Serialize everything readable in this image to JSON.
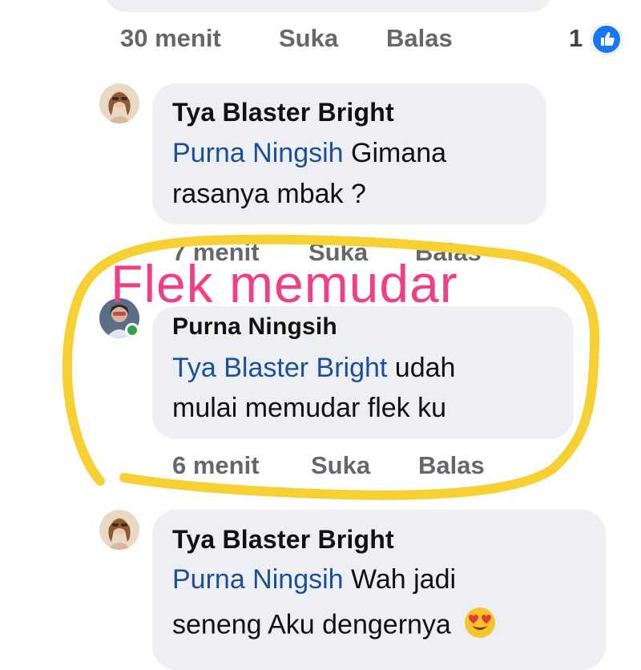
{
  "top_comment": {
    "time": "30 menit",
    "like_label": "Suka",
    "reply_label": "Balas",
    "reaction_count": "1",
    "reaction_icon": "thumbs-up-icon"
  },
  "replies": [
    {
      "author": "Tya Blaster Bright",
      "mention": "Purna Ningsih",
      "text_line1": " Gimana",
      "text_line2": "rasanya mbak ?",
      "time": "7 menit",
      "like_label": "Suka",
      "reply_label": "Balas"
    },
    {
      "author": "Purna Ningsih",
      "mention": "Tya Blaster Bright",
      "text_line1": "  udah",
      "text_line2": "mulai memudar flek ku",
      "time": "6 menit",
      "like_label": "Suka",
      "reply_label": "Balas"
    },
    {
      "author": "Tya Blaster Bright",
      "mention": "Purna Ningsih",
      "text_line1": " Wah jadi",
      "text_line2": "seneng Aku dengernya",
      "emoji": "😍"
    }
  ],
  "annotation": {
    "text": "Flek memudar",
    "color": "#ef3f86",
    "circle_color": "#f7d033"
  },
  "colors": {
    "mention": "#1b4f9c",
    "bubble": "#edeff2",
    "meta": "#65676b",
    "like_blue": "#1877f2"
  }
}
